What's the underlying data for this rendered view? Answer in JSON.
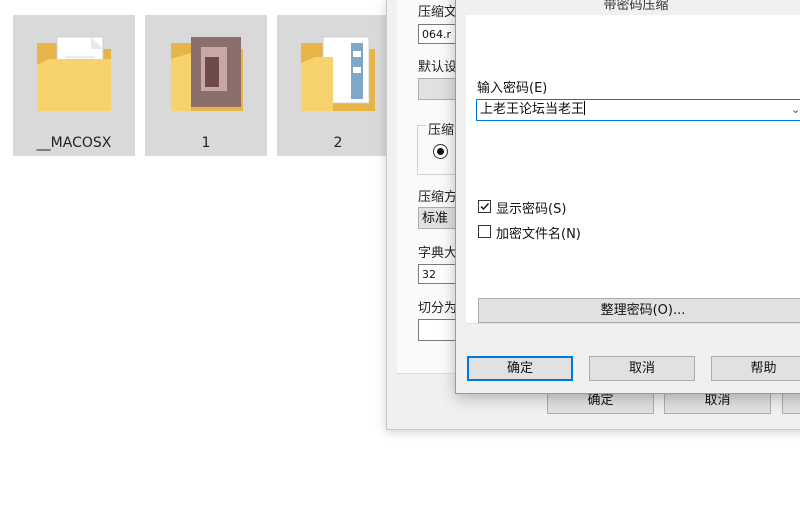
{
  "folders": [
    {
      "name": "__MACOSX",
      "icon": "folder-with-document-icon"
    },
    {
      "name": "1",
      "icon": "folder-with-photo-icon"
    },
    {
      "name": "2",
      "icon": "folder-with-document-icon"
    }
  ],
  "archive_dialog": {
    "label_archive_name": "压缩文",
    "archive_name_value": "064.r",
    "label_default_profile": "默认设",
    "label_archive_format": "压缩",
    "label_compression_method": "压缩方",
    "compression_method_value": "标准",
    "label_dictionary_size": "字典大",
    "dictionary_size_value": "32",
    "label_split": "切分为",
    "ok_label": "确定",
    "cancel_label": "取消"
  },
  "password_dialog": {
    "title": "带密码压缩",
    "enter_password_label": "输入密码(E)",
    "password_value": "上老王论坛当老王",
    "show_password_label": "显示密码(S)",
    "show_password_checked": true,
    "encrypt_filenames_label": "加密文件名(N)",
    "encrypt_filenames_checked": false,
    "organize_passwords_label": "整理密码(O)...",
    "ok_label": "确定",
    "cancel_label": "取消",
    "help_label": "帮助"
  },
  "colors": {
    "tile_background": "#d9d9d9",
    "folder_yellow": "#f6d36c",
    "focus_blue": "#0078d7"
  }
}
